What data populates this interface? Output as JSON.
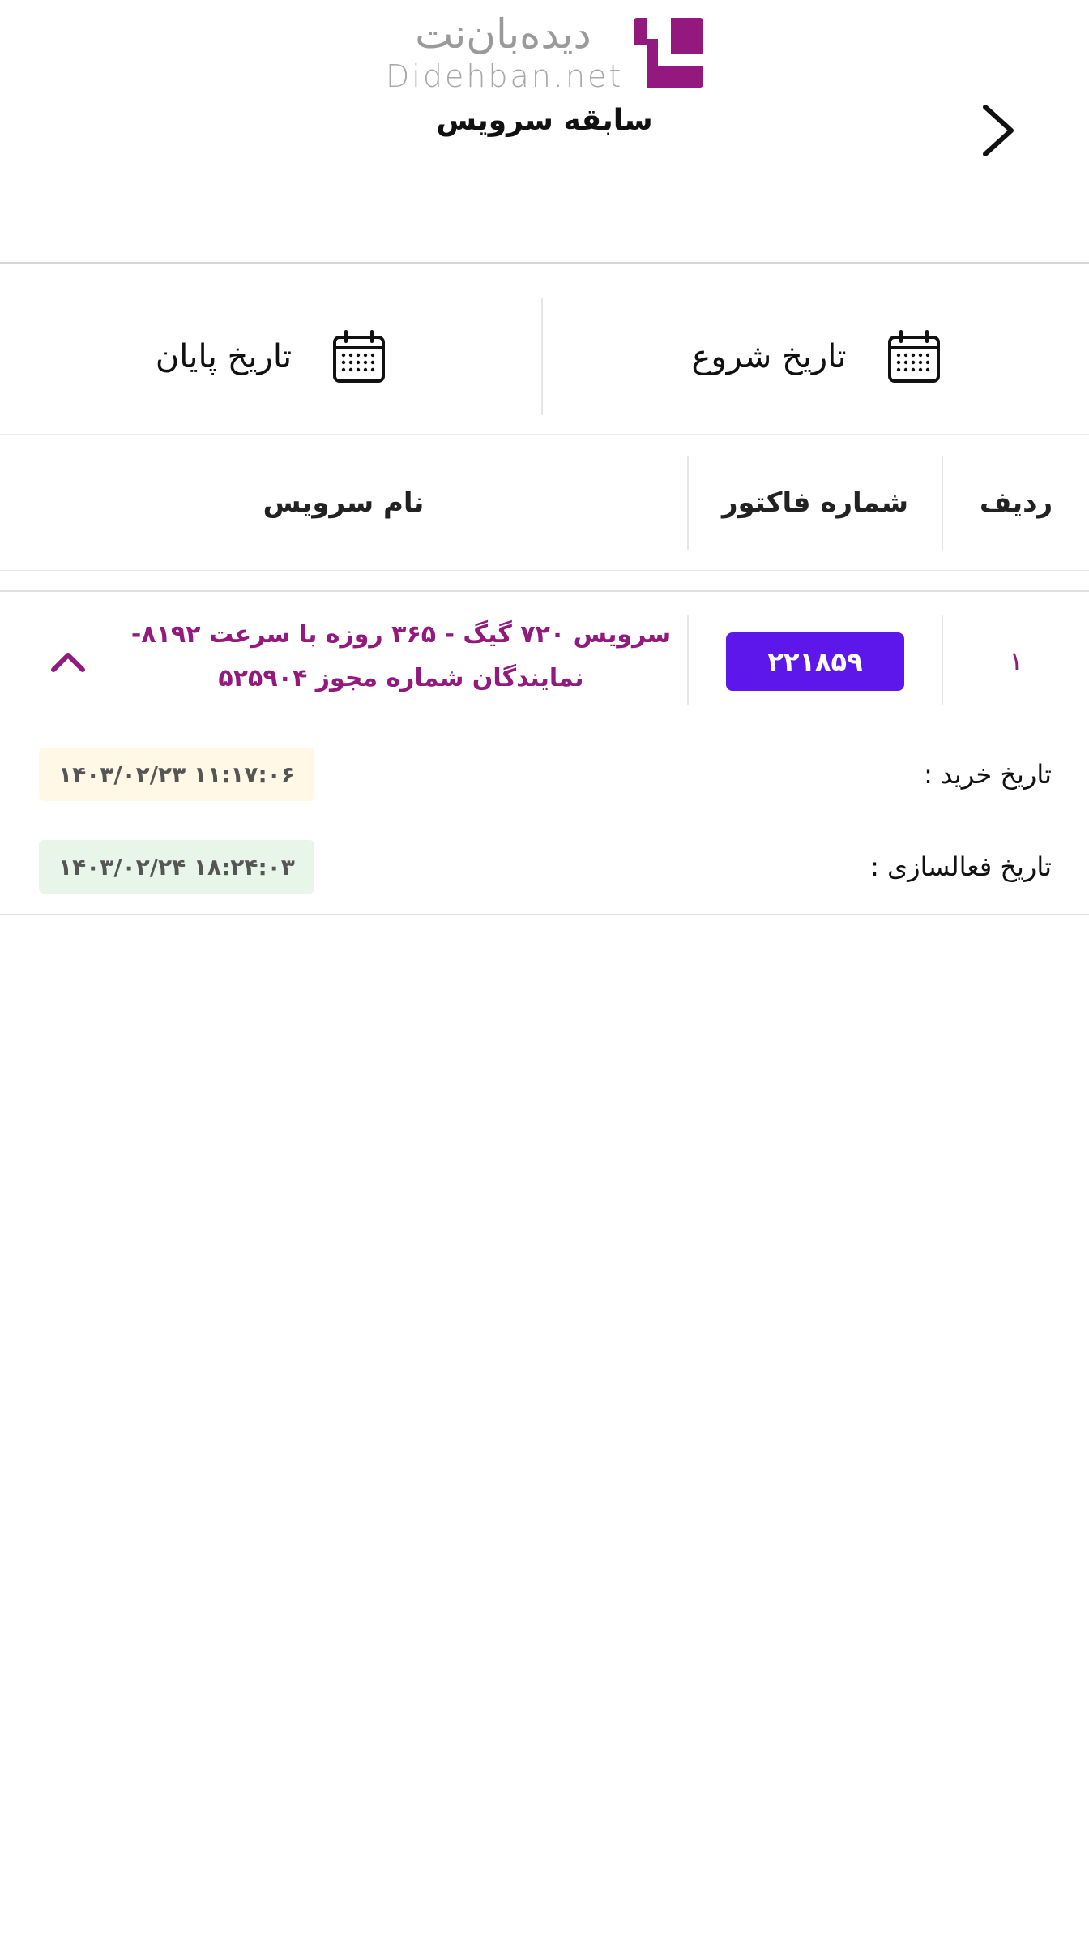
{
  "header": {
    "logo_fa": "دیده‌بان‌نت",
    "logo_en": "Didehban.net",
    "title": "سابقه سرویس",
    "back_icon": "chevron-right-icon"
  },
  "filters": {
    "start_date_label": "تاریخ شروع",
    "end_date_label": "تاریخ پایان",
    "icon": "calendar-icon"
  },
  "table": {
    "headers": {
      "row": "ردیف",
      "invoice": "شماره فاکتور",
      "service": "نام سرویس"
    },
    "rows": [
      {
        "row": "۱",
        "invoice": "۲۲۱۸۵۹",
        "service_line1": "سرویس ۷۲۰ گیگ - ۳۶۵ روزه با سرعت ۸۱۹۲-",
        "service_line2": "نمایندگان شماره مجوز ۵۲۵۹۰۴",
        "purchase_label": "تاریخ خرید :",
        "purchase_value": "۱۴۰۳/۰۲/۲۳ ۱۱:۱۷:۰۶",
        "activation_label": "تاریخ فعالسازی :",
        "activation_value": "۱۴۰۳/۰۲/۲۴ ۱۸:۲۴:۰۳"
      }
    ]
  },
  "colors": {
    "brand": "#93197f",
    "invoice_badge": "#5e17eb",
    "purchase_bg": "#fff8e6",
    "activation_bg": "#e8f5e9"
  }
}
